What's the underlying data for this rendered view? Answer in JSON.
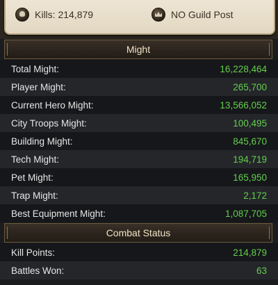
{
  "summary": {
    "kills": "Kills: 214,879",
    "guild_post": "NO Guild Post"
  },
  "icons": {
    "kills_icon": "skull-icon",
    "guild_icon": "crown-icon"
  },
  "colors": {
    "value_green": "#62d04c",
    "header_gold": "#6e5a3e"
  },
  "might": {
    "header": "Might",
    "rows": [
      {
        "label": "Total Might:",
        "value": "16,228,464"
      },
      {
        "label": "Player Might:",
        "value": "265,700"
      },
      {
        "label": "Current Hero Might:",
        "value": "13,566,052"
      },
      {
        "label": "City Troops Might:",
        "value": "100,495"
      },
      {
        "label": "Building Might:",
        "value": "845,670"
      },
      {
        "label": "Tech Might:",
        "value": "194,719"
      },
      {
        "label": "Pet Might:",
        "value": "165,950"
      },
      {
        "label": "Trap Might:",
        "value": "2,172"
      },
      {
        "label": "Best Equipment Might:",
        "value": "1,087,705"
      }
    ]
  },
  "combat": {
    "header": "Combat Status",
    "rows": [
      {
        "label": "Kill Points:",
        "value": "214,879"
      },
      {
        "label": "Battles Won:",
        "value": "63"
      }
    ]
  }
}
